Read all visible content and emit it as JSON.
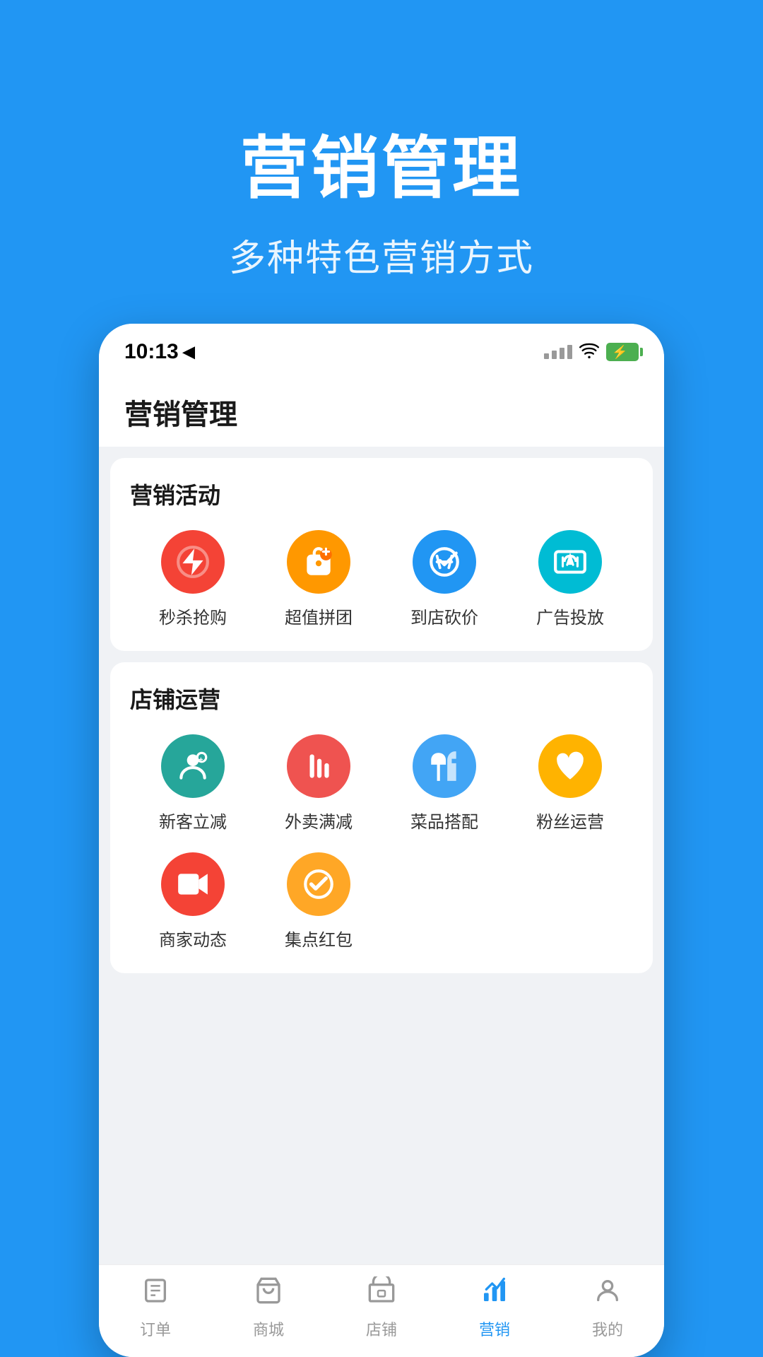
{
  "header": {
    "main_title": "营销管理",
    "sub_title": "多种特色营销方式"
  },
  "status_bar": {
    "time": "10:13",
    "arrow": "▶"
  },
  "app_header": {
    "title": "营销管理"
  },
  "sections": [
    {
      "id": "marketing_activities",
      "title": "营销活动",
      "items": [
        {
          "label": "秒杀抢购",
          "icon_type": "flash",
          "color_class": "icon-red"
        },
        {
          "label": "超值拼团",
          "icon_type": "puzzle",
          "color_class": "icon-orange"
        },
        {
          "label": "到店砍价",
          "icon_type": "tag",
          "color_class": "icon-blue"
        },
        {
          "label": "广告投放",
          "icon_type": "chart",
          "color_class": "icon-teal"
        }
      ]
    },
    {
      "id": "store_operations",
      "title": "店铺运营",
      "items": [
        {
          "label": "新客立减",
          "icon_type": "person",
          "color_class": "icon-green-teal"
        },
        {
          "label": "外卖满减",
          "icon_type": "food",
          "color_class": "icon-red-bar"
        },
        {
          "label": "菜品搭配",
          "icon_type": "thumb",
          "color_class": "icon-blue-thumb"
        },
        {
          "label": "粉丝运营",
          "icon_type": "heart",
          "color_class": "icon-yellow-heart"
        },
        {
          "label": "商家动态",
          "icon_type": "video",
          "color_class": "icon-red-video"
        },
        {
          "label": "集点红包",
          "icon_type": "check",
          "color_class": "icon-orange-check"
        }
      ]
    }
  ],
  "bottom_nav": {
    "items": [
      {
        "id": "orders",
        "label": "订单",
        "icon": "orders",
        "active": false
      },
      {
        "id": "mall",
        "label": "商城",
        "icon": "mall",
        "active": false
      },
      {
        "id": "store",
        "label": "店铺",
        "icon": "store",
        "active": false
      },
      {
        "id": "marketing",
        "label": "营销",
        "icon": "marketing",
        "active": true
      },
      {
        "id": "mine",
        "label": "我的",
        "icon": "mine",
        "active": false
      }
    ]
  },
  "colors": {
    "primary_blue": "#2196F3",
    "background_blue": "#2196F3"
  }
}
